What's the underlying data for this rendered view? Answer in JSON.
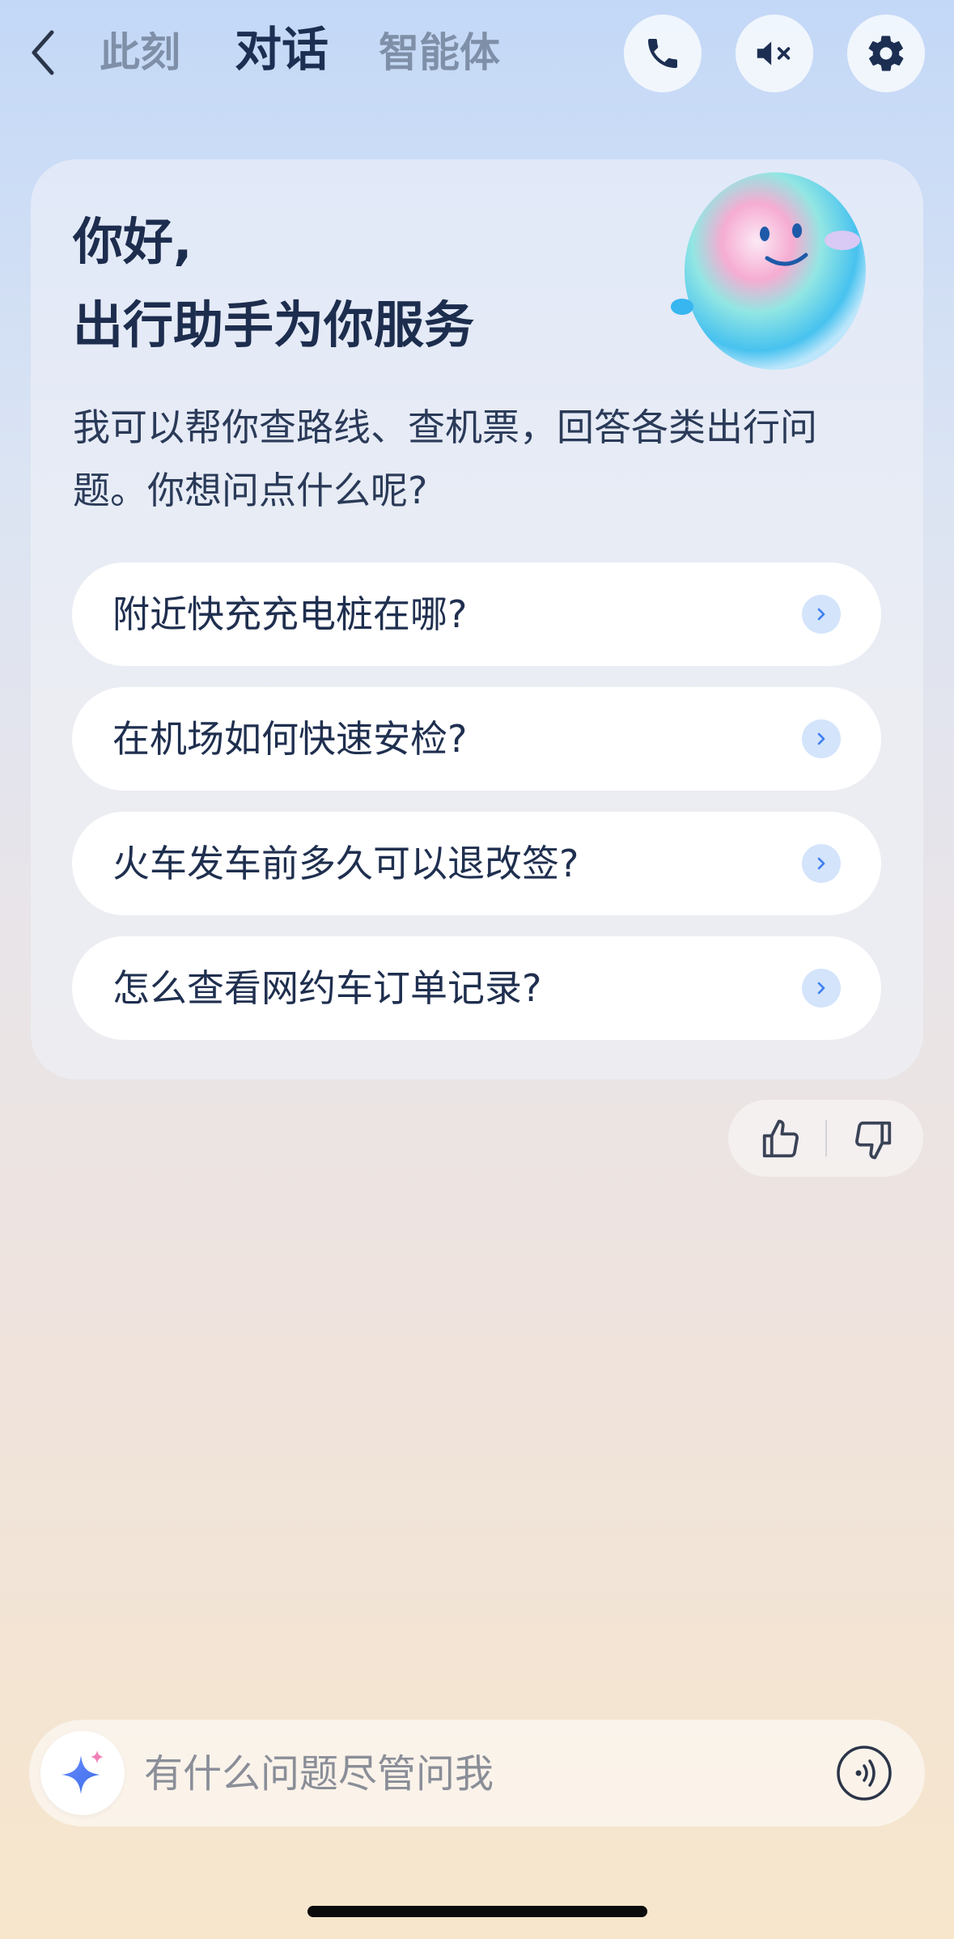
{
  "header": {
    "tabs": [
      {
        "label": "此刻",
        "active": false
      },
      {
        "label": "对话",
        "active": true
      },
      {
        "label": "智能体",
        "active": false
      }
    ],
    "icons": [
      "back-chevron-icon",
      "phone-icon",
      "speaker-mute-icon",
      "gear-icon"
    ]
  },
  "card": {
    "greeting_line1": "你好,",
    "greeting_line2": "出行助手为你服务",
    "description": "我可以帮你查路线、查机票，回答各类出行问题。你想问点什么呢?",
    "suggestions": [
      {
        "label": "附近快充充电桩在哪?"
      },
      {
        "label": "在机场如何快速安检?"
      },
      {
        "label": "火车发车前多久可以退改签?"
      },
      {
        "label": "怎么查看网约车订单记录?"
      }
    ]
  },
  "feedback": {
    "icons": [
      "thumbs-up-icon",
      "thumbs-down-icon"
    ]
  },
  "input": {
    "placeholder": "有什么问题尽管问我",
    "value": ""
  },
  "colors": {
    "accent": "#3f7ef0",
    "title": "#1c2f52",
    "inactive_tab": "#7f8fa8",
    "chip_arrow_bg": "#d3e4fb"
  }
}
